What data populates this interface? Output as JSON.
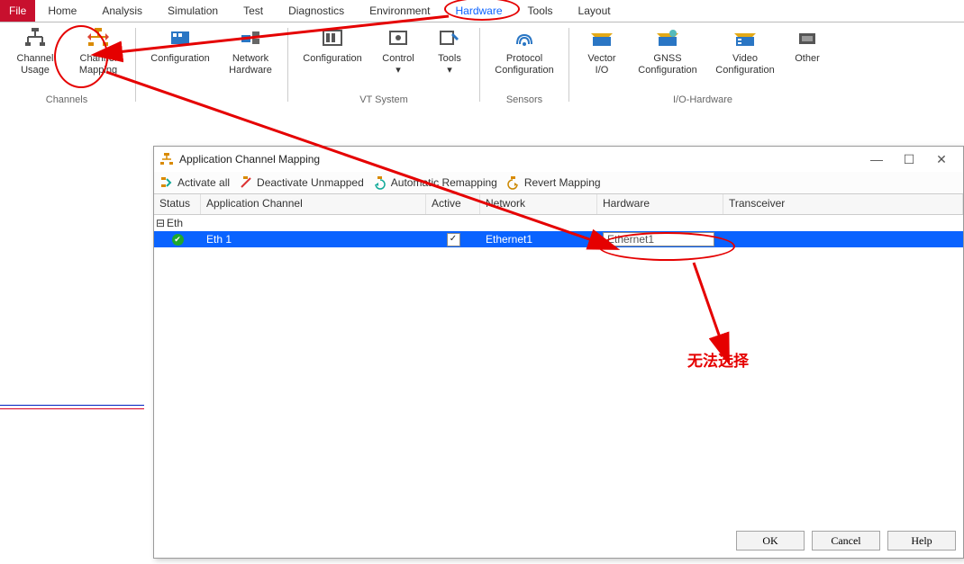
{
  "menu": {
    "file": "File",
    "items": [
      "Home",
      "Analysis",
      "Simulation",
      "Test",
      "Diagnostics",
      "Environment",
      "Hardware",
      "Tools",
      "Layout"
    ]
  },
  "ribbon": {
    "groups": [
      {
        "label": "Channels",
        "items": [
          {
            "name": "channel-usage",
            "text": "Channel\nUsage",
            "icon": "ch-usage"
          },
          {
            "name": "channel-mapping",
            "text": "Channel\nMapping",
            "icon": "ch-map"
          }
        ]
      },
      {
        "label": "",
        "items": [
          {
            "name": "configuration",
            "text": "Configuration",
            "icon": "board"
          },
          {
            "name": "network-hardware",
            "text": "Network\nHardware",
            "icon": "nethw"
          }
        ]
      },
      {
        "label": "VT System",
        "items": [
          {
            "name": "vt-config",
            "text": "Configuration",
            "icon": "vtcfg"
          },
          {
            "name": "vt-control",
            "text": "Control",
            "icon": "vtctrl",
            "dd": true
          },
          {
            "name": "vt-tools",
            "text": "Tools",
            "icon": "vttool",
            "dd": true
          }
        ]
      },
      {
        "label": "Sensors",
        "items": [
          {
            "name": "protocol-config",
            "text": "Protocol\nConfiguration",
            "icon": "proto"
          }
        ]
      },
      {
        "label": "I/O-Hardware",
        "items": [
          {
            "name": "vector-io",
            "text": "Vector\nI/O",
            "icon": "vio"
          },
          {
            "name": "gnss-config",
            "text": "GNSS\nConfiguration",
            "icon": "gnss"
          },
          {
            "name": "video-config",
            "text": "Video\nConfiguration",
            "icon": "video"
          },
          {
            "name": "other",
            "text": "Other",
            "icon": "other"
          }
        ]
      }
    ]
  },
  "dialog": {
    "title": "Application Channel Mapping",
    "toolbar": {
      "activate_all": "Activate all",
      "deactivate_unmapped": "Deactivate Unmapped",
      "auto_remap": "Automatic Remapping",
      "revert": "Revert Mapping"
    },
    "columns": {
      "status": "Status",
      "app": "Application Channel",
      "active": "Active",
      "net": "Network",
      "hw": "Hardware",
      "trans": "Transceiver"
    },
    "group": {
      "label": "Eth"
    },
    "row": {
      "status": "ok",
      "app": "Eth 1",
      "active": true,
      "net": "Ethernet1",
      "hw": "Ethernet1",
      "trans": ""
    },
    "buttons": {
      "ok": "OK",
      "cancel": "Cancel",
      "help": "Help"
    }
  },
  "annotation": {
    "cannot_select": "无法选择"
  }
}
